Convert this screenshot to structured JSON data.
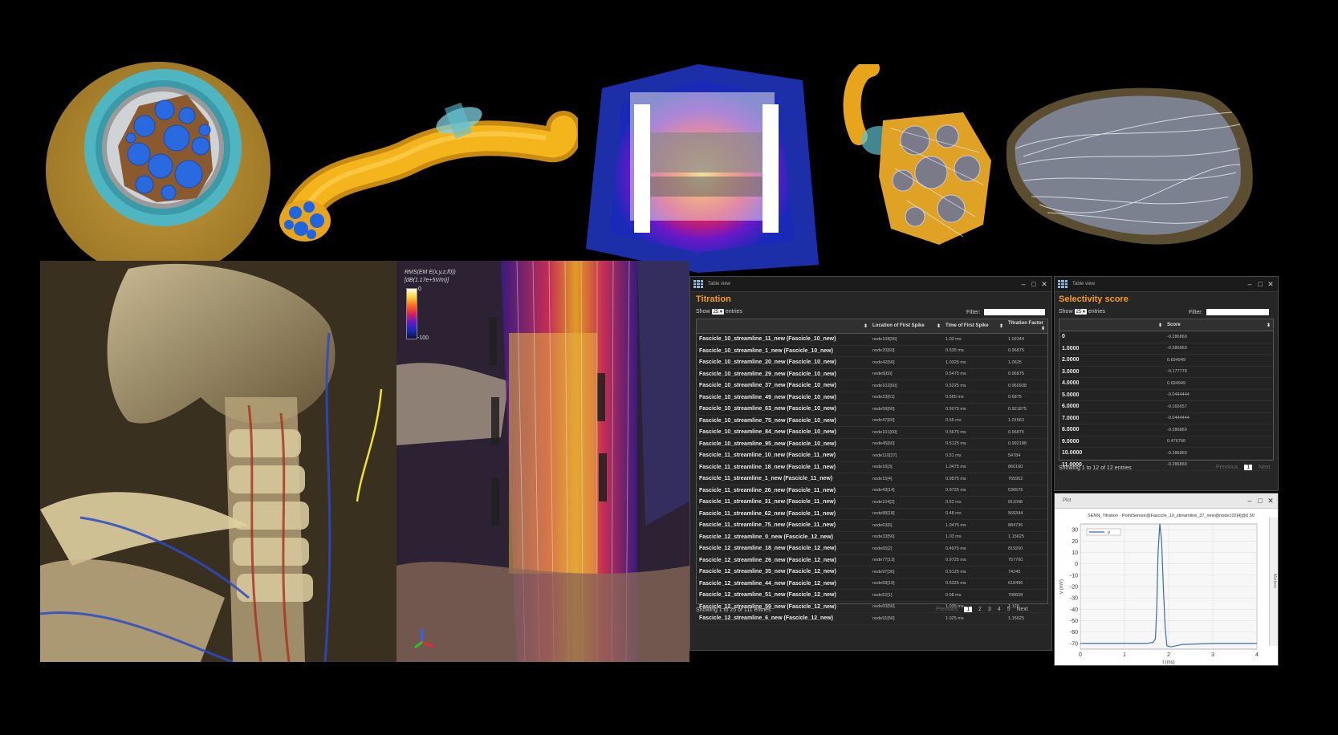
{
  "titration": {
    "window_title": "Table view",
    "title": "Titration",
    "show_label": "Show",
    "show_value": "25",
    "entries_label": "entries",
    "filter_label": "Filter:",
    "columns": [
      "",
      "Location of First Spike",
      "Time of First Spike",
      "Titration Factor"
    ],
    "rows": [
      [
        "Fascicle_10_streamline_11_new (Fascicle_10_new)",
        "node108[56]",
        "1.03 ms",
        "1.02344"
      ],
      [
        "Fascicle_10_streamline_1_new (Fascicle_10_new)",
        "node20[60]",
        "0.535 ms",
        "0.96875"
      ],
      [
        "Fascicle_10_streamline_20_new (Fascicle_10_new)",
        "node42[56]",
        "1.0325 ms",
        "1.0625"
      ],
      [
        "Fascicle_10_streamline_29_new (Fascicle_10_new)",
        "node6[60]",
        "0.5475 ms",
        "0.96875"
      ],
      [
        "Fascicle_10_streamline_37_new (Fascicle_10_new)",
        "node102[60]",
        "0.5225 ms",
        "0.960938"
      ],
      [
        "Fascicle_10_streamline_49_new (Fascicle_10_new)",
        "node23[61]",
        "0.565 ms",
        "0.6875"
      ],
      [
        "Fascicle_10_streamline_63_new (Fascicle_10_new)",
        "node59[60]",
        "0.5075 ms",
        "0.921875"
      ],
      [
        "Fascicle_10_streamline_75_new (Fascicle_10_new)",
        "node47[60]",
        "0.55 ms",
        "1.01563"
      ],
      [
        "Fascicle_10_streamline_84_new (Fascicle_10_new)",
        "node101[60]",
        "0.5675 ms",
        "0.96875"
      ],
      [
        "Fascicle_10_streamline_95_new (Fascicle_10_new)",
        "node45[60]",
        "0.5125 ms",
        "0.992188"
      ],
      [
        "Fascicle_11_streamline_10_new (Fascicle_11_new)",
        "node110[37]",
        "0.51 ms",
        "54784"
      ],
      [
        "Fascicle_11_streamline_18_new (Fascicle_11_new)",
        "node16[3]",
        "1.0475 ms",
        "860160"
      ],
      [
        "Fascicle_11_streamline_1_new (Fascicle_11_new)",
        "node15[4]",
        "0.9875 ms",
        "765952"
      ],
      [
        "Fascicle_11_streamline_26_new (Fascicle_11_new)",
        "node43[14]",
        "0.9725 ms",
        "536576"
      ],
      [
        "Fascicle_11_streamline_31_new (Fascicle_11_new)",
        "node104[2]",
        "0.52 ms",
        "811008"
      ],
      [
        "Fascicle_11_streamline_62_new (Fascicle_11_new)",
        "node88[18]",
        "0.48 ms",
        "569344"
      ],
      [
        "Fascicle_11_streamline_75_new (Fascicle_11_new)",
        "node63[6]",
        "1.0475 ms",
        "884736"
      ],
      [
        "Fascicle_12_streamline_0_new (Fascicle_12_new)",
        "node33[56]",
        "1.03 ms",
        "1.15625"
      ],
      [
        "Fascicle_12_streamline_18_new (Fascicle_12_new)",
        "node65[2]",
        "0.4975 ms",
        "819200"
      ],
      [
        "Fascicle_12_streamline_26_new (Fascicle_12_new)",
        "node77[13]",
        "0.9725 ms",
        "757760"
      ],
      [
        "Fascicle_12_streamline_35_new (Fascicle_12_new)",
        "node97[36]",
        "0.5125 ms",
        "74240"
      ],
      [
        "Fascicle_12_streamline_44_new (Fascicle_12_new)",
        "node68[10]",
        "0.5325 ms",
        "618496"
      ],
      [
        "Fascicle_12_streamline_51_new (Fascicle_12_new)",
        "node52[1]",
        "0.98 ms",
        "708608"
      ],
      [
        "Fascicle_12_streamline_59_new (Fascicle_12_new)",
        "node60[56]",
        "1.035 ms",
        "1.125"
      ],
      [
        "Fascicle_12_streamline_6_new (Fascicle_12_new)",
        "node91[56]",
        "1.025 ms",
        "1.15625"
      ]
    ],
    "info": "Showing 1 to 25 of 111 entries",
    "pager": {
      "previous": "Previous",
      "pages": [
        "1",
        "2",
        "3",
        "4",
        "5"
      ],
      "next": "Next"
    }
  },
  "selectivity": {
    "window_title": "Table view",
    "title": "Selectivity score",
    "show_label": "Show",
    "show_value": "25",
    "entries_label": "entries",
    "filter_label": "Filter:",
    "columns": [
      "",
      "Score"
    ],
    "rows": [
      [
        "0",
        "-0.286869"
      ],
      [
        "1.0000",
        "-0.286869"
      ],
      [
        "2.0000",
        "0.694949"
      ],
      [
        "3.0000",
        "-0.177778"
      ],
      [
        "4.0000",
        "0.694949"
      ],
      [
        "5.0000",
        "-0.0444444"
      ],
      [
        "6.0000",
        "-0.165657"
      ],
      [
        "7.0000",
        "-0.0444444"
      ],
      [
        "8.0000",
        "-0.286869"
      ],
      [
        "9.0000",
        "0.476768"
      ],
      [
        "10.0000",
        "-0.286869"
      ],
      [
        "11.0000",
        "-0.286869"
      ]
    ],
    "info": "Showing 1 to 12 of 12 entries",
    "pager": {
      "previous": "Previous",
      "page": "1",
      "next": "Next"
    }
  },
  "plot": {
    "window_title": "Plot",
    "side_tab": "Markers",
    "chart_data": {
      "type": "line",
      "title": "SENN_Titration - PointSensor@Fascicle_10_streamline_37_new@node102[4]@0.50",
      "xlabel": "t (ms)",
      "ylabel": "v (mV)",
      "xlim": [
        0,
        4
      ],
      "ylim": [
        -75,
        35
      ],
      "xticks": [
        "0",
        "1",
        "2",
        "3",
        "4"
      ],
      "yticks": [
        "30",
        "20",
        "10",
        "0",
        "-10",
        "-20",
        "-30",
        "-40",
        "-50",
        "-60",
        "-70"
      ],
      "legend": "v",
      "series": [
        {
          "name": "v",
          "color": "#3a6ea5",
          "x": [
            0,
            1.5,
            1.65,
            1.7,
            1.73,
            1.76,
            1.8,
            1.84,
            1.88,
            1.92,
            1.96,
            2.05,
            2.3,
            3,
            4
          ],
          "y": [
            -70,
            -70,
            -69,
            -66,
            -40,
            10,
            35,
            20,
            -20,
            -55,
            -72,
            -73,
            -71,
            -70,
            -70
          ]
        }
      ]
    }
  },
  "colorbar": {
    "label_line1": "RMS(EM E(x,y,z,f0))",
    "label_line2": "[dB(1.17e+5V/m)]",
    "max": "0",
    "min": "-100"
  }
}
